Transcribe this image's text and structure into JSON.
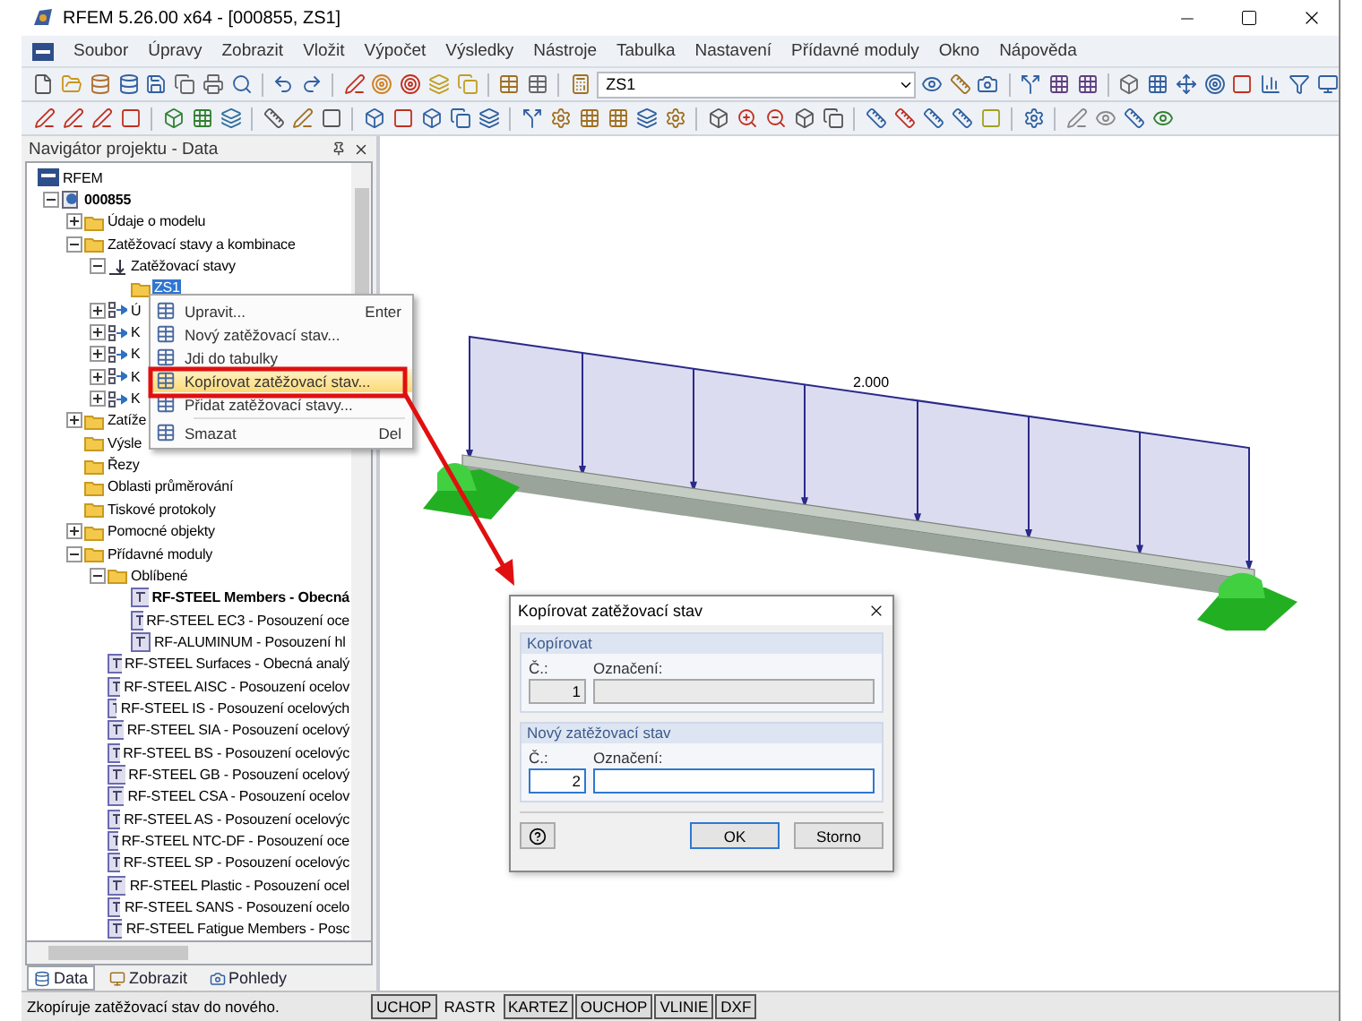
{
  "window": {
    "title": "RFEM 5.26.00 x64 - [000855, ZS1]"
  },
  "menu": [
    "Soubor",
    "Úpravy",
    "Zobrazit",
    "Vložit",
    "Výpočet",
    "Výsledky",
    "Nástroje",
    "Tabulka",
    "Nastavení",
    "Přídavné moduly",
    "Okno",
    "Nápověda"
  ],
  "toolbar": {
    "load_case": "ZS1"
  },
  "navigator": {
    "title": "Navigátor projektu - Data",
    "tree": [
      {
        "label": "RFEM",
        "kind": "root",
        "children": [
          {
            "label": "000855",
            "kind": "model",
            "bold": true,
            "expanded": true,
            "children": [
              {
                "label": "Údaje o modelu",
                "kind": "folder",
                "expanded": false
              },
              {
                "label": "Zatěžovací stavy a kombinace",
                "kind": "folder",
                "expanded": true,
                "children": [
                  {
                    "label": "Zatěžovací stavy",
                    "kind": "loadcases",
                    "expanded": true,
                    "children": [
                      {
                        "label": "ZS1",
                        "kind": "folder",
                        "selected": true
                      }
                    ]
                  },
                  {
                    "label": "Ú",
                    "kind": "combo",
                    "expanded": false
                  },
                  {
                    "label": "K",
                    "kind": "combo",
                    "expanded": false
                  },
                  {
                    "label": "K",
                    "kind": "combo",
                    "expanded": false
                  },
                  {
                    "label": "K",
                    "kind": "combo",
                    "expanded": false
                  },
                  {
                    "label": "K",
                    "kind": "combo",
                    "expanded": false
                  }
                ]
              },
              {
                "label": "Zatíže",
                "kind": "folder",
                "expanded": false
              },
              {
                "label": "Výsle",
                "kind": "folder"
              },
              {
                "label": "Řezy",
                "kind": "folder"
              },
              {
                "label": "Oblasti průměrování",
                "kind": "folder"
              },
              {
                "label": "Tiskové protokoly",
                "kind": "folder"
              },
              {
                "label": "Pomocné objekty",
                "kind": "folder",
                "expanded": false
              },
              {
                "label": "Přídavné moduly",
                "kind": "folder",
                "expanded": true,
                "children": [
                  {
                    "label": "Oblíbené",
                    "kind": "folder",
                    "expanded": true,
                    "children": [
                      {
                        "label": "RF-STEEL Members - Obecná",
                        "kind": "module",
                        "bold": true
                      },
                      {
                        "label": "RF-STEEL EC3 - Posouzení oce",
                        "kind": "module"
                      },
                      {
                        "label": "RF-ALUMINUM - Posouzení hl",
                        "kind": "module"
                      }
                    ]
                  },
                  {
                    "label": "RF-STEEL Surfaces - Obecná analý",
                    "kind": "module"
                  },
                  {
                    "label": "RF-STEEL AISC - Posouzení ocelov",
                    "kind": "module"
                  },
                  {
                    "label": "RF-STEEL IS - Posouzení ocelových",
                    "kind": "module"
                  },
                  {
                    "label": "RF-STEEL SIA - Posouzení ocelový",
                    "kind": "module"
                  },
                  {
                    "label": "RF-STEEL BS - Posouzení ocelovýc",
                    "kind": "module"
                  },
                  {
                    "label": "RF-STEEL GB - Posouzení ocelový",
                    "kind": "module"
                  },
                  {
                    "label": "RF-STEEL CSA - Posouzení ocelov",
                    "kind": "module"
                  },
                  {
                    "label": "RF-STEEL AS - Posouzení ocelovýc",
                    "kind": "module"
                  },
                  {
                    "label": "RF-STEEL NTC-DF - Posouzení oce",
                    "kind": "module"
                  },
                  {
                    "label": "RF-STEEL SP - Posouzení ocelovýc",
                    "kind": "module"
                  },
                  {
                    "label": "RF-STEEL Plastic - Posouzení ocel",
                    "kind": "module"
                  },
                  {
                    "label": "RF-STEEL SANS - Posouzení ocelo",
                    "kind": "module"
                  },
                  {
                    "label": "RF-STEEL Fatigue Members - Posc",
                    "kind": "module"
                  }
                ]
              }
            ]
          }
        ]
      }
    ],
    "tabs": [
      {
        "label": "Data",
        "selected": true
      },
      {
        "label": "Zobrazit",
        "selected": false
      },
      {
        "label": "Pohledy",
        "selected": false
      }
    ]
  },
  "context_menu": {
    "items": [
      {
        "kind": "item",
        "label": "Upravit...",
        "shortcut": "Enter",
        "highlighted": false
      },
      {
        "kind": "item",
        "label": "Nový zatěžovací stav...",
        "highlighted": false
      },
      {
        "kind": "item",
        "label": "Jdi do tabulky",
        "highlighted": false
      },
      {
        "kind": "item",
        "label": "Kopírovat zatěžovací stav...",
        "highlighted": true
      },
      {
        "kind": "item",
        "label": "Přidat zatěžovací stavy...",
        "highlighted": false
      },
      {
        "kind": "separator"
      },
      {
        "kind": "item",
        "label": "Smazat",
        "shortcut": "Del",
        "highlighted": false
      }
    ]
  },
  "canvas": {
    "load_value": "2.000"
  },
  "dialog": {
    "title": "Kopírovat zatěžovací stav",
    "groups": [
      {
        "title": "Kopírovat",
        "number_label": "Č.:",
        "name_label": "Označení:",
        "number": "1",
        "disabled": true
      },
      {
        "title": "Nový zatěžovací stav",
        "number_label": "Č.:",
        "name_label": "Označení:",
        "number": "2",
        "disabled": false
      }
    ],
    "buttons": [
      "OK",
      "Storno"
    ]
  },
  "status_bar": {
    "text": "Zkopíruje zatěžovací stav do nového.",
    "toggles": [
      {
        "label": "UCHOP",
        "on": true
      },
      {
        "label": "RASTR",
        "on": false
      },
      {
        "label": "KARTEZ",
        "on": true
      },
      {
        "label": "OUCHOP",
        "on": true
      },
      {
        "label": "VLINIE",
        "on": true
      },
      {
        "label": "DXF",
        "on": true
      }
    ]
  }
}
